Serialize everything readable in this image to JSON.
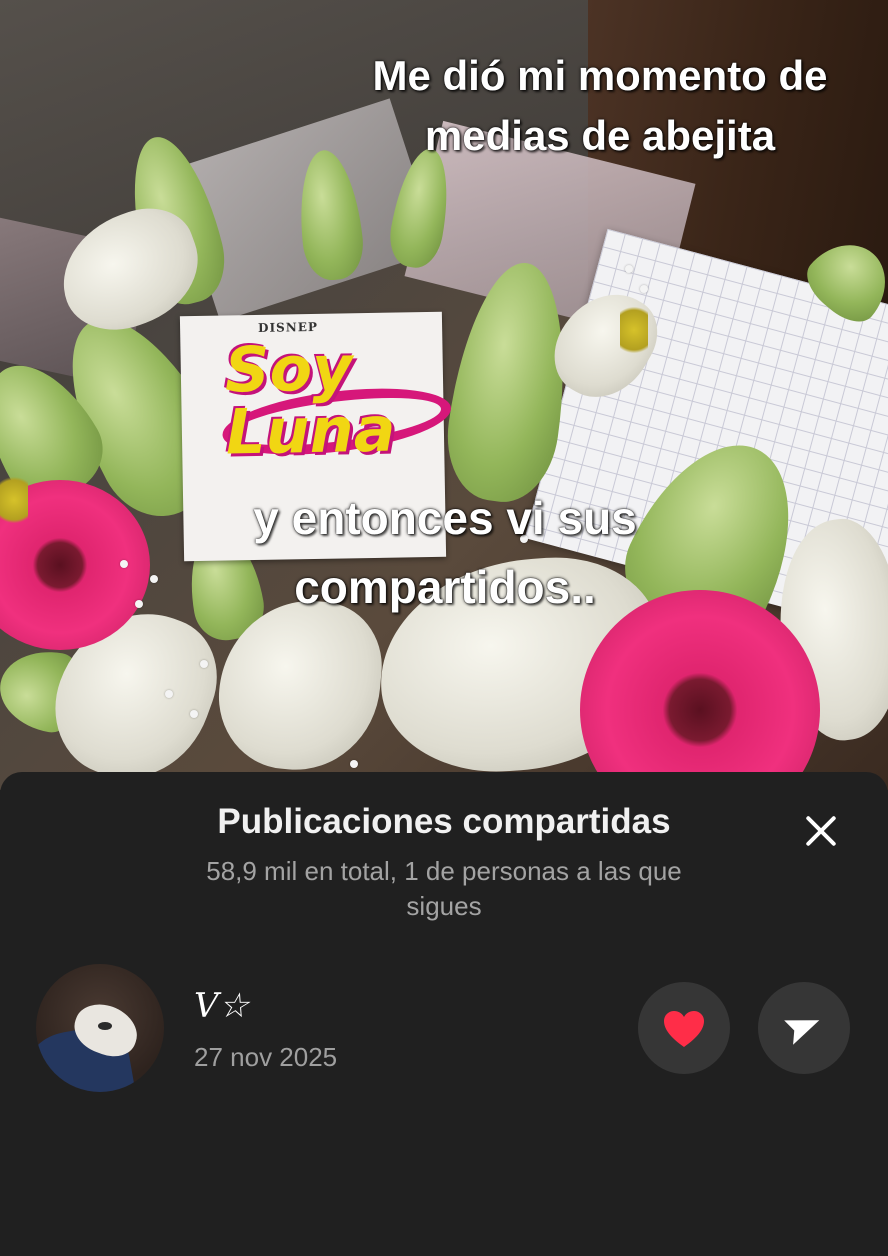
{
  "video": {
    "caption_top": "Me dió mi momento de\nmedias de abejita",
    "caption_middle": "y entonces vi sus\ncompartidos.."
  },
  "sheet": {
    "title": "Publicaciones compartidas",
    "subtitle": "58,9 mil en total, 1 de personas a las que\nsigues",
    "close_icon": "close-icon"
  },
  "shares": [
    {
      "user_name": "V☆",
      "date": "27 nov 2025",
      "like_icon": "heart-icon",
      "like_color": "#ff2d48",
      "send_icon": "send-icon"
    }
  ]
}
